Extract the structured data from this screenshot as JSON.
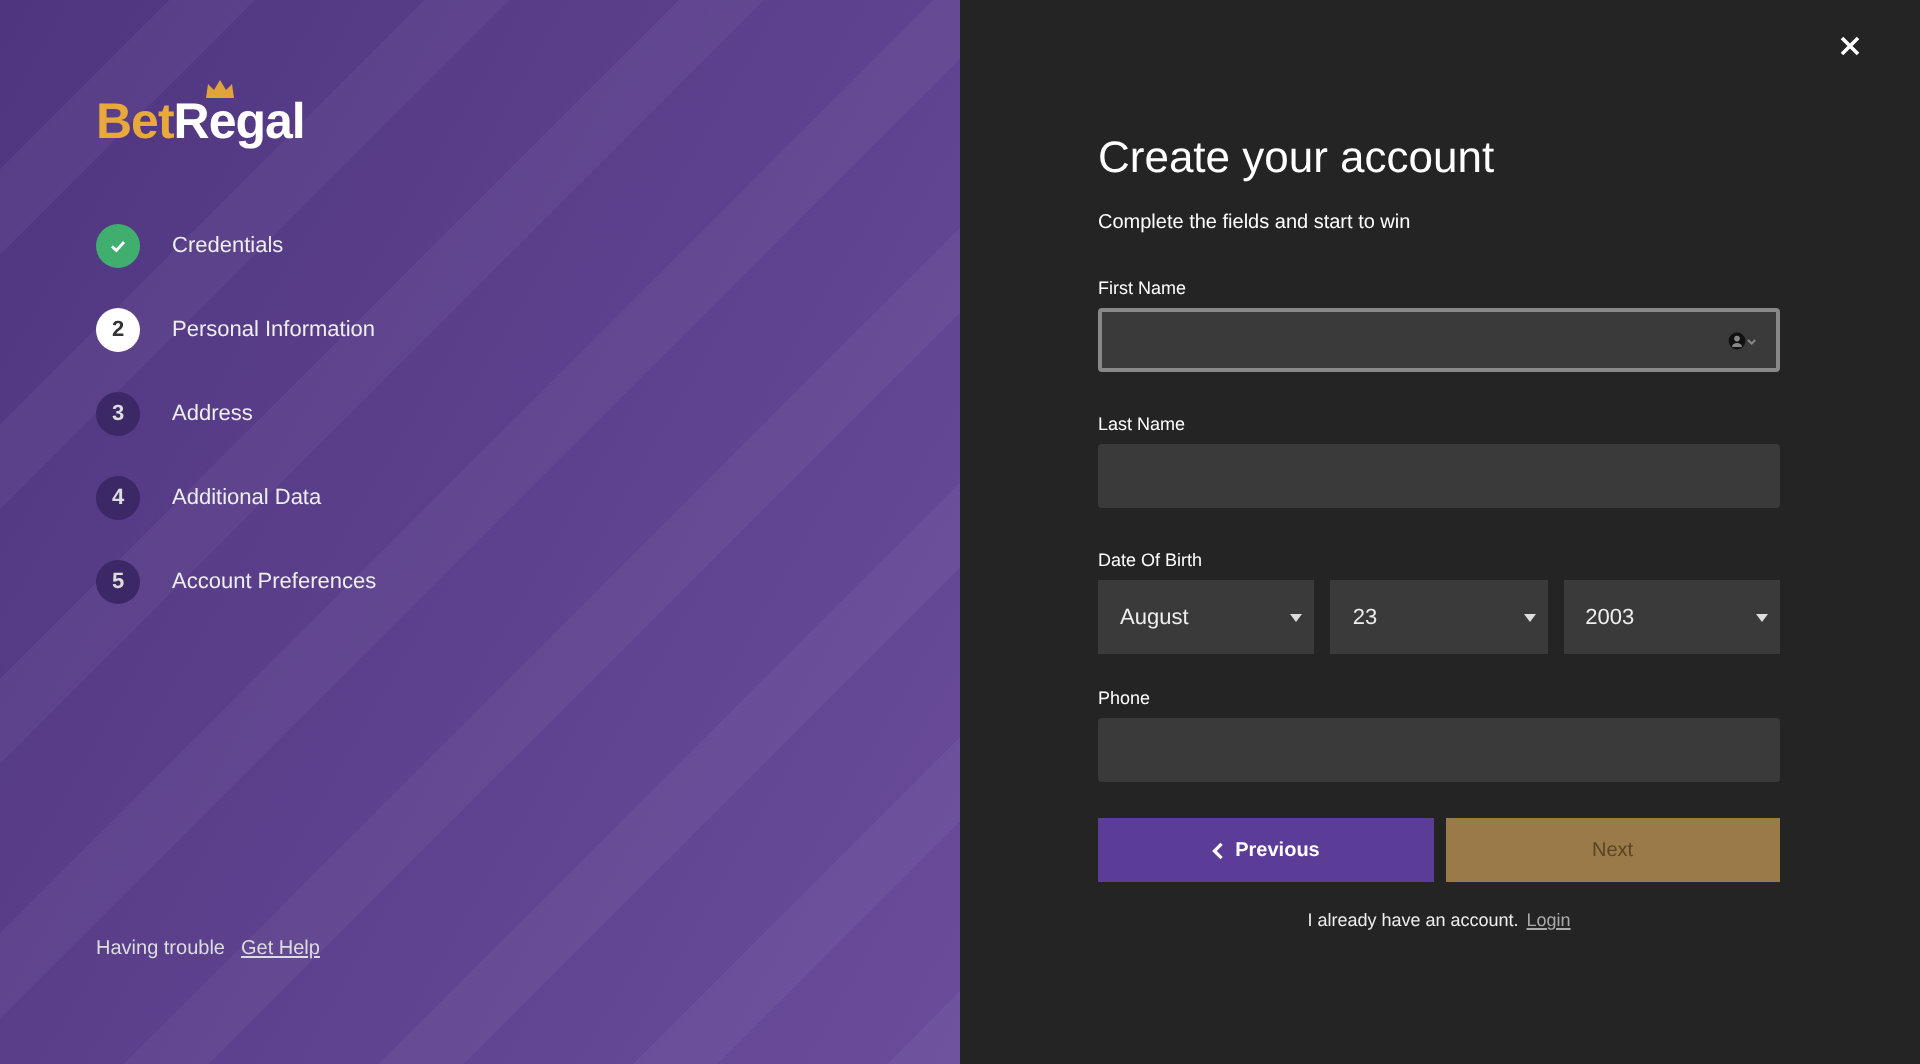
{
  "logo": {
    "part_1": "Bet",
    "part_2": "Regal"
  },
  "steps": [
    {
      "label": "Credentials",
      "kind": "done"
    },
    {
      "number": "2",
      "label": "Personal Information",
      "kind": "current"
    },
    {
      "number": "3",
      "label": "Address",
      "kind": "pending"
    },
    {
      "number": "4",
      "label": "Additional Data",
      "kind": "pending"
    },
    {
      "number": "5",
      "label": "Account Preferences",
      "kind": "pending"
    }
  ],
  "help": {
    "text": "Having trouble",
    "link": "Get Help"
  },
  "form": {
    "title": "Create your account",
    "subtitle": "Complete the fields and start to win",
    "first_name": {
      "label": "First Name",
      "focused": true
    },
    "last_name": {
      "label": "Last Name",
      "focused": false
    },
    "date_of_birth": {
      "label": "Date Of Birth",
      "selects": [
        {
          "value": "August"
        },
        {
          "value": "23"
        },
        {
          "value": "2003"
        }
      ]
    },
    "phone": {
      "label": "Phone",
      "focused": false
    },
    "previous_button": "Previous",
    "next_button": {
      "label": "Next",
      "disabled": true
    },
    "login_prompt": {
      "text": "I already have an account.",
      "link": "Login"
    }
  }
}
